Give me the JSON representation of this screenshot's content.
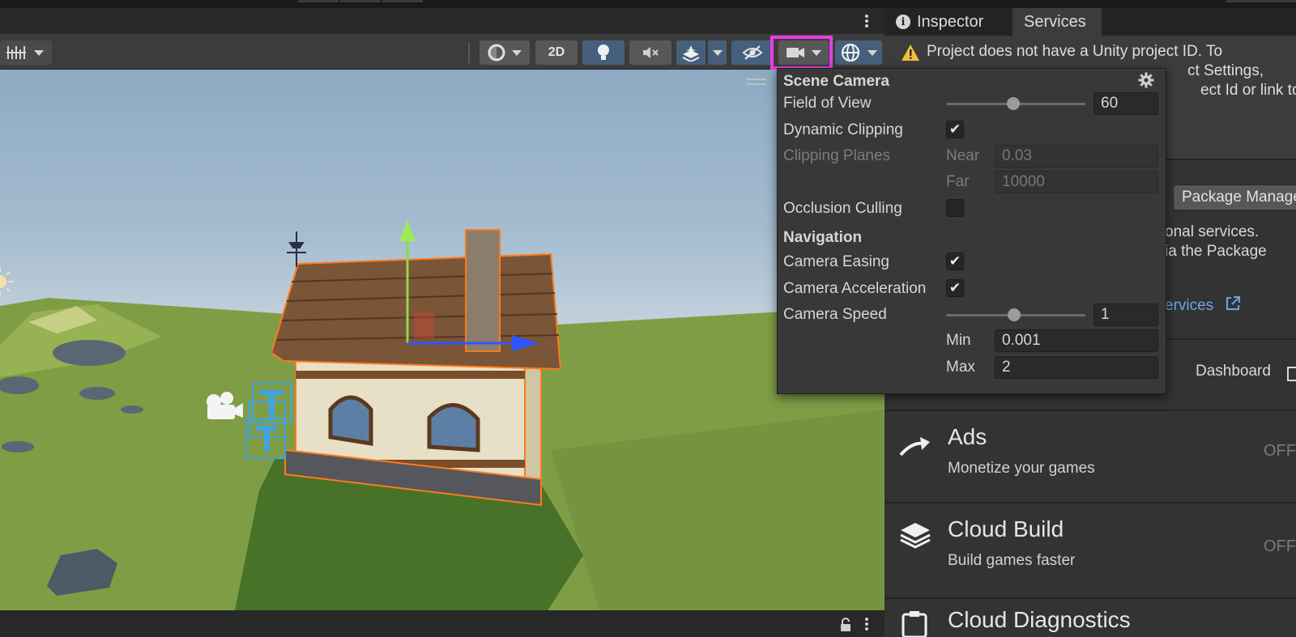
{
  "scene_view": {
    "toolbar": {
      "mode_2d_label": "2D"
    }
  },
  "scene_camera_popup": {
    "title": "Scene Camera",
    "field_of_view": {
      "label": "Field of View",
      "value": "60",
      "slider_fraction": 0.48
    },
    "dynamic_clipping": {
      "label": "Dynamic Clipping",
      "checked": true
    },
    "clipping_planes": {
      "label": "Clipping Planes",
      "near_label": "Near",
      "near_value": "0.03",
      "far_label": "Far",
      "far_value": "10000"
    },
    "occlusion_culling": {
      "label": "Occlusion Culling",
      "checked": false
    },
    "navigation_header": "Navigation",
    "camera_easing": {
      "label": "Camera Easing",
      "checked": true
    },
    "camera_acceleration": {
      "label": "Camera Acceleration",
      "checked": true
    },
    "camera_speed": {
      "label": "Camera Speed",
      "value": "1",
      "slider_fraction": 0.49,
      "min_label": "Min",
      "min_value": "0.001",
      "max_label": "Max",
      "max_value": "2"
    }
  },
  "right_panel": {
    "tabs": [
      {
        "label": "Inspector"
      },
      {
        "label": "Services"
      }
    ],
    "warning": {
      "line1": "Project does not have a Unity project ID. To",
      "line2": "ct Settings,",
      "line3": "ect Id or link to an"
    },
    "package_manager_button": "Package Manager",
    "services_text_1": "onal services.",
    "services_text_2": "ia the Package",
    "services_link": "ervices",
    "dashboard_label": "Dashboard",
    "services": [
      {
        "title": "Ads",
        "subtitle": "Monetize your games",
        "status": "OFF"
      },
      {
        "title": "Cloud Build",
        "subtitle": "Build games faster",
        "status": "OFF"
      },
      {
        "title": "Cloud Diagnostics"
      }
    ]
  },
  "colors": {
    "highlight": "#e83be8",
    "selection_outline": "#ff7a1a",
    "accent_link": "#6ea3e8",
    "toggle_on": "#46607c"
  }
}
